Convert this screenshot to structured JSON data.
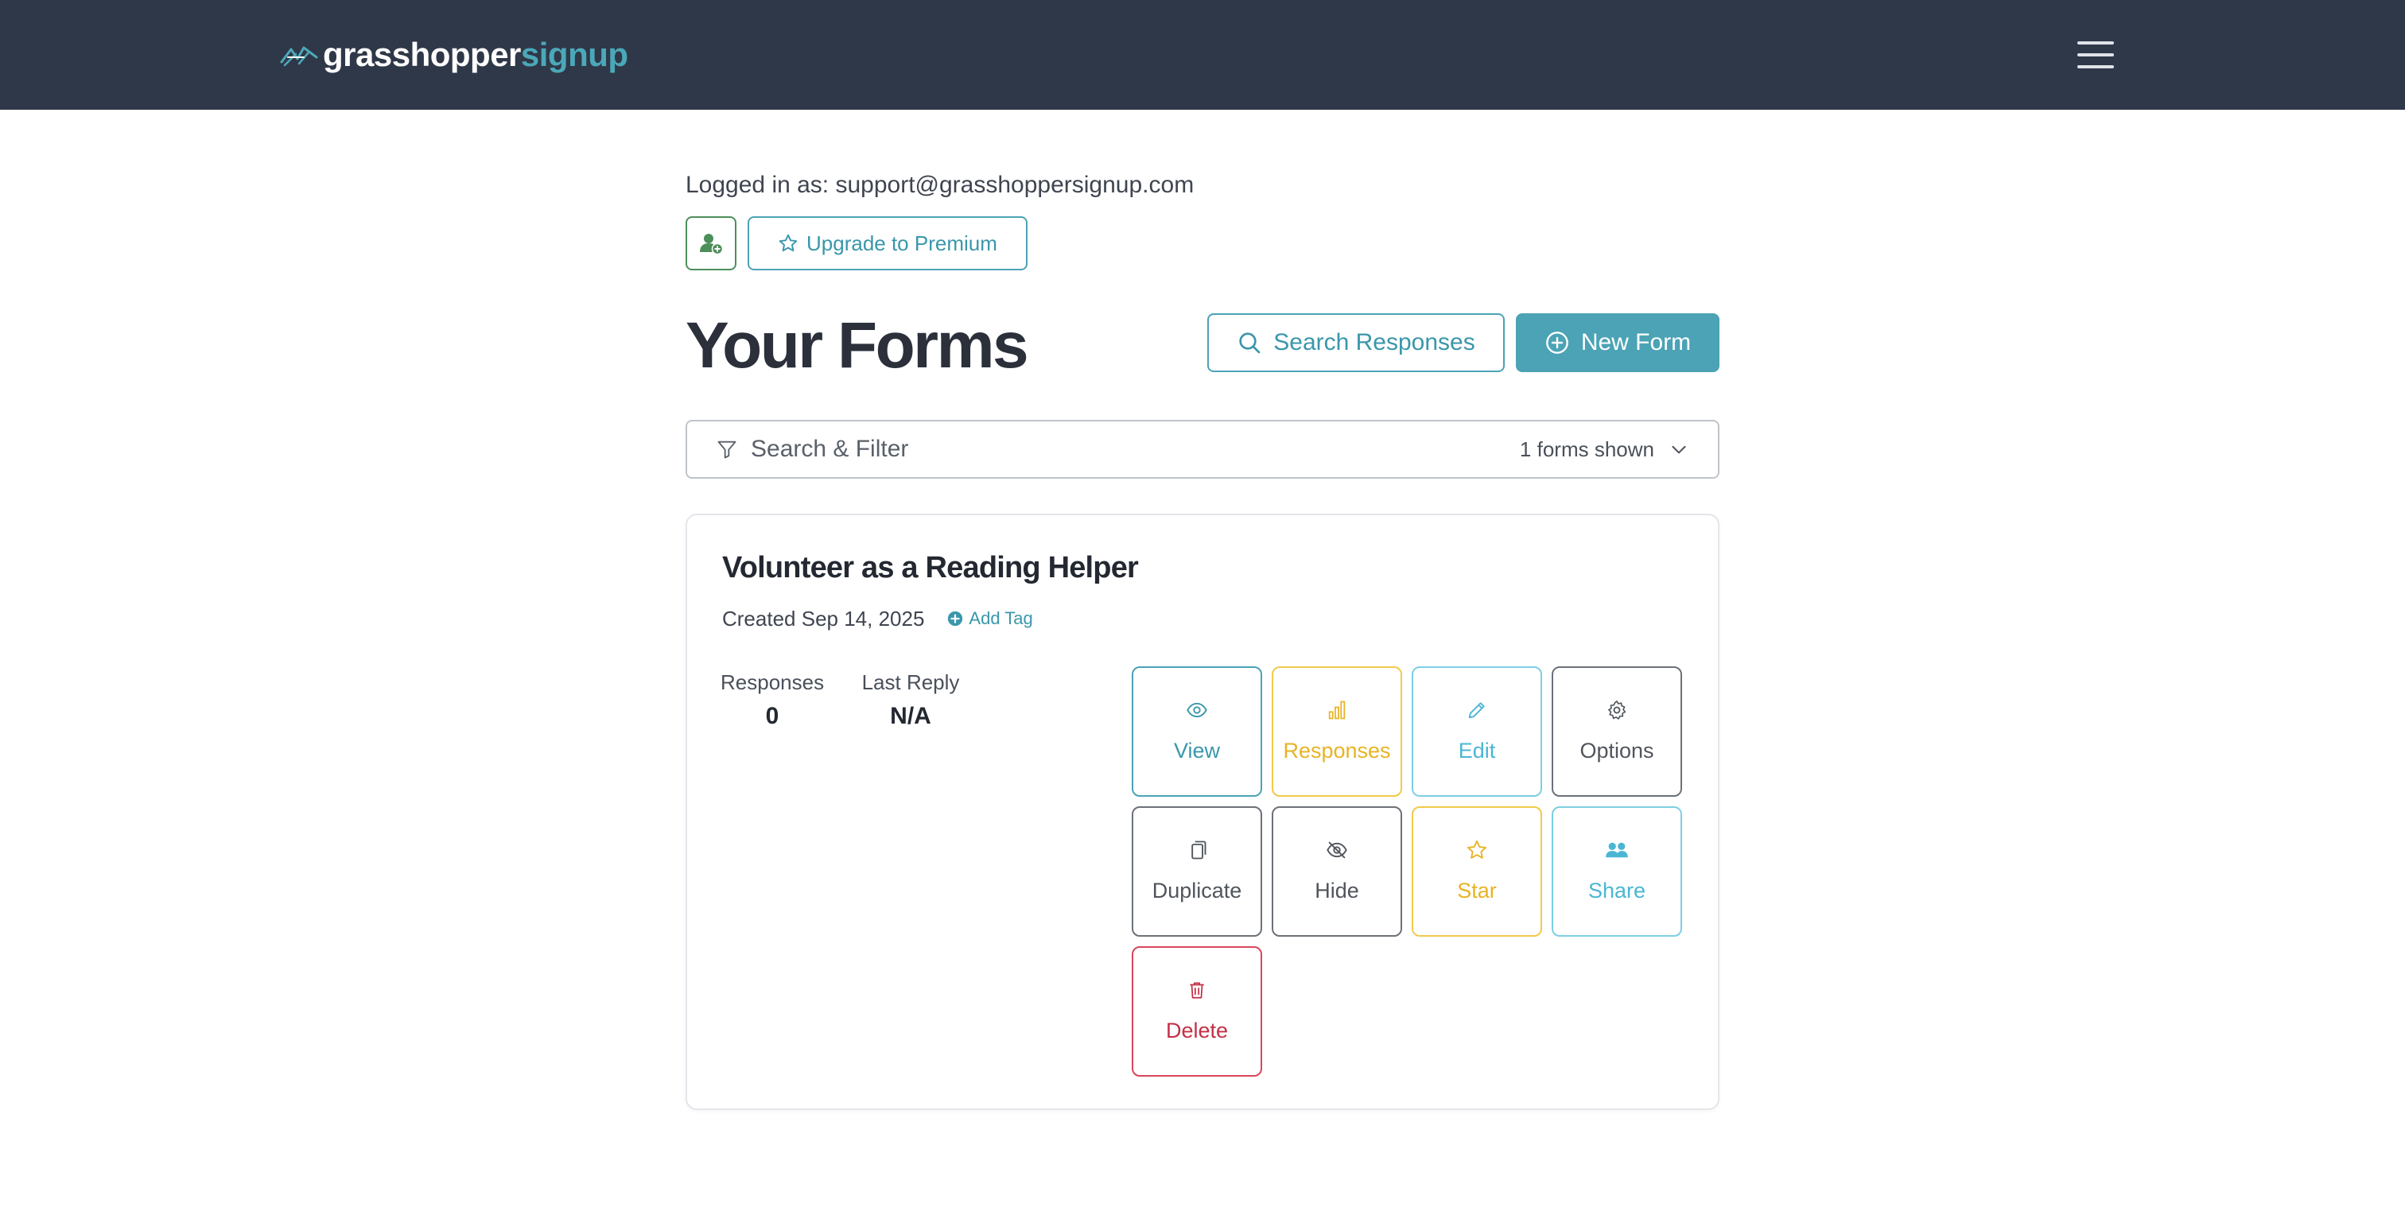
{
  "header": {
    "logo_part1": "grasshopper",
    "logo_part2": "signup"
  },
  "account": {
    "logged_in_text": "Logged in as: support@grasshoppersignup.com",
    "upgrade_label": "Upgrade to Premium"
  },
  "page": {
    "title": "Your Forms",
    "search_responses_label": "Search Responses",
    "new_form_label": "New Form"
  },
  "filter": {
    "label": "Search & Filter",
    "count_text": "1 forms shown"
  },
  "forms": [
    {
      "title": "Volunteer as a Reading Helper",
      "created": "Created Sep 14, 2025",
      "add_tag_label": "Add Tag",
      "responses_label": "Responses",
      "responses_value": "0",
      "last_reply_label": "Last Reply",
      "last_reply_value": "N/A",
      "actions": {
        "view": "View",
        "responses": "Responses",
        "edit": "Edit",
        "options": "Options",
        "duplicate": "Duplicate",
        "hide": "Hide",
        "star": "Star",
        "share": "Share",
        "delete": "Delete"
      }
    }
  ],
  "colors": {
    "navbar": "#2f3848",
    "accent": "#4ba3b5",
    "yellow": "#e8b324",
    "cyan": "#4bb6d3",
    "red": "#c42f45",
    "green": "#4d8f5a"
  },
  "icons": {
    "add_user": "user-plus-icon",
    "upgrade": "star-outline-icon",
    "search": "magnifier-icon",
    "new": "plus-circle-icon",
    "filter": "funnel-icon",
    "dropdown": "chevron-down-icon",
    "menu": "hamburger-icon"
  }
}
